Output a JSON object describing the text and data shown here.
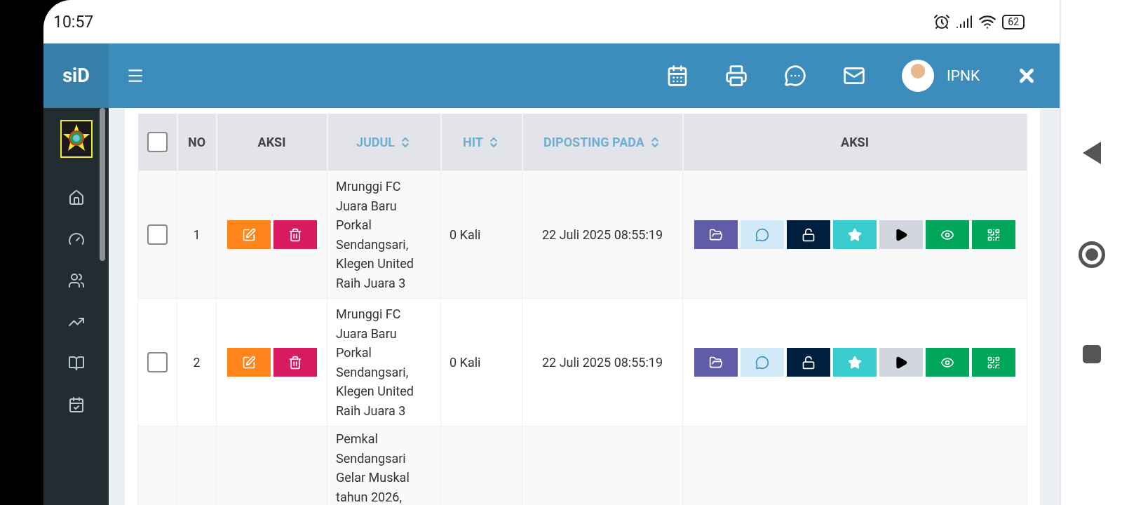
{
  "status_bar": {
    "time": "10:57",
    "battery": "62"
  },
  "header": {
    "brand": "siD",
    "user": "IPNK"
  },
  "sidebar": {
    "items": [
      {
        "kind": "home"
      },
      {
        "kind": "dashboard"
      },
      {
        "kind": "users"
      },
      {
        "kind": "stats"
      },
      {
        "kind": "book"
      },
      {
        "kind": "calendar"
      }
    ]
  },
  "table": {
    "columns": [
      {
        "kind": "checkbox",
        "checked": false
      },
      {
        "kind": "text",
        "label": "NO",
        "sortable": false
      },
      {
        "kind": "text",
        "label": "AKSI",
        "sortable": false
      },
      {
        "kind": "text",
        "label": "JUDUL",
        "sortable": true
      },
      {
        "kind": "text",
        "label": "HIT",
        "sortable": true
      },
      {
        "kind": "text",
        "label": "DIPOSTING PADA",
        "sortable": true
      },
      {
        "kind": "text",
        "label": "AKSI",
        "sortable": false
      }
    ],
    "rows": [
      {
        "checked": false,
        "no": "1",
        "title": "Mrunggi FC Juara Baru Porkal Sendangsari, Klegen United Raih Juara 3",
        "hit": "0 Kali",
        "posted": "22 Juli 2025 08:55:19",
        "edit_actions": [
          {
            "kind": "edit",
            "color": "#ff851b"
          },
          {
            "kind": "delete",
            "color": "#d81b60"
          }
        ],
        "actions": [
          {
            "kind": "folder",
            "color": "#605ca8"
          },
          {
            "kind": "comment",
            "color": "#d2e9f7"
          },
          {
            "kind": "unlock",
            "color": "#001f3f"
          },
          {
            "kind": "star",
            "color": "#39cccc"
          },
          {
            "kind": "play",
            "color": "#d2d6de"
          },
          {
            "kind": "view",
            "color": "#00a65a"
          },
          {
            "kind": "qr",
            "color": "#00a65a"
          }
        ]
      },
      {
        "checked": false,
        "no": "2",
        "title": "Mrunggi FC Juara Baru Porkal Sendangsari, Klegen United Raih Juara 3",
        "hit": "0 Kali",
        "posted": "22 Juli 2025 08:55:19",
        "edit_actions": [
          {
            "kind": "edit",
            "color": "#ff851b"
          },
          {
            "kind": "delete",
            "color": "#d81b60"
          }
        ],
        "actions": [
          {
            "kind": "folder",
            "color": "#605ca8"
          },
          {
            "kind": "comment",
            "color": "#d2e9f7"
          },
          {
            "kind": "unlock",
            "color": "#001f3f"
          },
          {
            "kind": "star",
            "color": "#39cccc"
          },
          {
            "kind": "play",
            "color": "#d2d6de"
          },
          {
            "kind": "view",
            "color": "#00a65a"
          },
          {
            "kind": "qr",
            "color": "#00a65a"
          }
        ]
      },
      {
        "title": "Pemkal Sendangsari Gelar Muskal tahun 2026,"
      }
    ]
  }
}
